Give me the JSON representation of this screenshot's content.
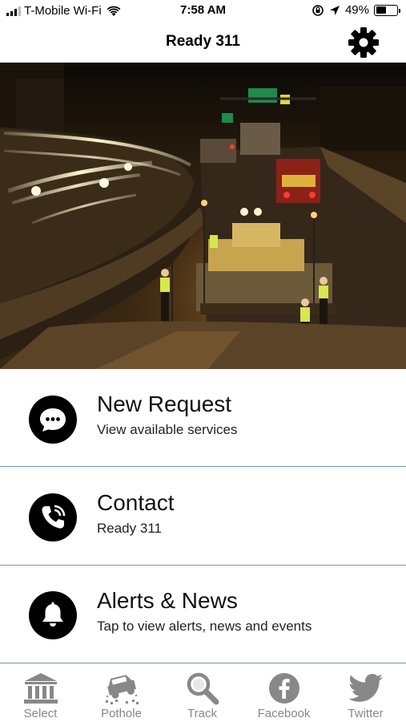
{
  "status_bar": {
    "carrier": "T-Mobile Wi-Fi",
    "time": "7:58 AM",
    "battery_percent": "49%",
    "battery_level": 0.49
  },
  "nav": {
    "title": "Ready 311",
    "settings_icon": "gear-icon"
  },
  "hero": {
    "description_icon": "highway-night-roadwork-photo"
  },
  "menu": [
    {
      "icon": "chat-bubble-icon",
      "title": "New Request",
      "subtitle": "View available services"
    },
    {
      "icon": "phone-icon",
      "title": "Contact",
      "subtitle": "Ready 311"
    },
    {
      "icon": "bell-icon",
      "title": "Alerts & News",
      "subtitle": "Tap to view alerts, news and events"
    }
  ],
  "tabs": [
    {
      "label": "Select",
      "icon": "bank-icon"
    },
    {
      "label": "Pothole",
      "icon": "car-pothole-icon"
    },
    {
      "label": "Track",
      "icon": "magnifier-icon"
    },
    {
      "label": "Facebook",
      "icon": "facebook-icon"
    },
    {
      "label": "Twitter",
      "icon": "twitter-icon"
    }
  ],
  "colors": {
    "divider": "#6f95b7",
    "tab_gray": "#888888",
    "icon_black": "#000000"
  }
}
